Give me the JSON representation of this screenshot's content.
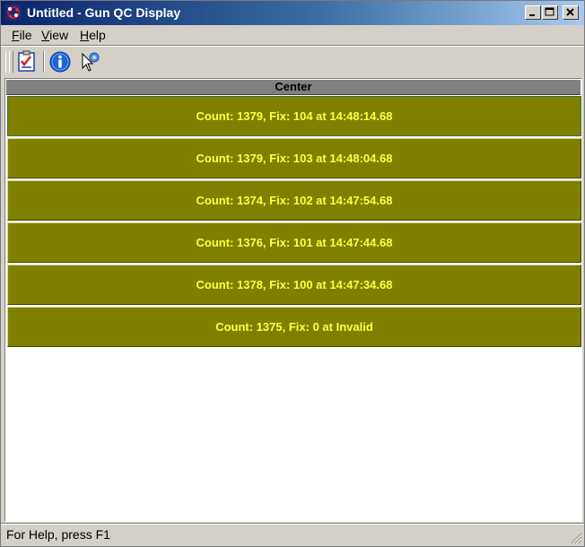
{
  "window": {
    "title": "Untitled - Gun QC Display"
  },
  "menu": [
    {
      "label_pre": "",
      "mnemonic": "F",
      "label_post": "ile"
    },
    {
      "label_pre": "",
      "mnemonic": "V",
      "label_post": "iew"
    },
    {
      "label_pre": "",
      "mnemonic": "H",
      "label_post": "elp"
    }
  ],
  "toolbar": {
    "icons": [
      "checklist-icon",
      "info-icon",
      "whats-this-help-icon"
    ]
  },
  "table": {
    "header": "Center",
    "rows": [
      "Count: 1379, Fix: 104 at 14:48:14.68",
      "Count: 1379, Fix: 103 at 14:48:04.68",
      "Count: 1374, Fix: 102 at 14:47:54.68",
      "Count: 1376, Fix: 101 at 14:47:44.68",
      "Count: 1378, Fix: 100 at 14:47:34.68",
      "Count: 1375, Fix: 0 at Invalid"
    ]
  },
  "colors": {
    "row_background": "#808000",
    "row_text": "#ffff40",
    "titlebar_start": "#0a246a",
    "titlebar_end": "#a6caf0"
  },
  "status": {
    "text": "For Help, press F1"
  }
}
